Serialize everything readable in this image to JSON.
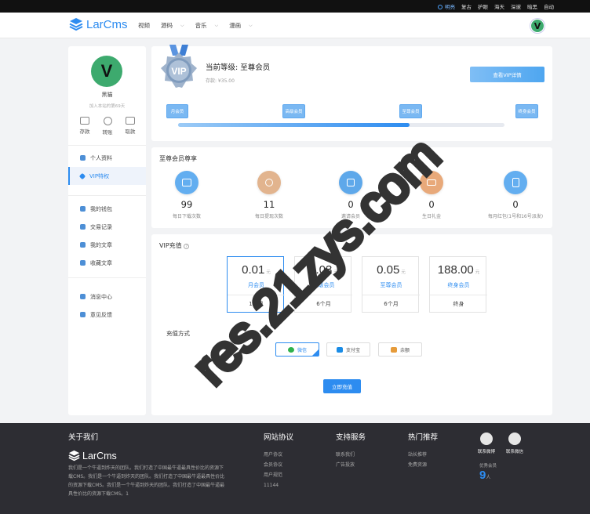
{
  "topbar": {
    "items": [
      "明亮",
      "复古",
      "护眼",
      "海天",
      "深邃",
      "暗黑",
      "自动"
    ]
  },
  "header": {
    "logo_text": "LarCms",
    "nav": [
      {
        "label": "视频",
        "caret": false
      },
      {
        "label": "源码",
        "caret": true
      },
      {
        "label": "音乐",
        "caret": true
      },
      {
        "label": "漫画",
        "caret": true
      }
    ],
    "avatar_letter": "V"
  },
  "sidebar": {
    "avatar_letter": "V",
    "username": "黑猫",
    "joined": "加入本站的第69天",
    "wallet": [
      "存款",
      "转账",
      "取款"
    ],
    "menu_group1": [
      "个人资料",
      "VIP特权"
    ],
    "menu_group2": [
      "我的钱包",
      "交易记录",
      "我的文章",
      "收藏文章"
    ],
    "menu_group3": [
      "消息中心",
      "意见反馈"
    ]
  },
  "level": {
    "badge_text": "VIP",
    "title": "当前等级: 至尊会员",
    "deposit": "存款: ¥35.00",
    "detail_button": "查看VIP详情",
    "milestones": [
      "月会员",
      "高级会员",
      "至尊会员",
      "终身会员"
    ],
    "progress": 0.71
  },
  "privileges": {
    "title": "至尊会员尊享",
    "items": [
      {
        "value": "99",
        "label": "每日下载次数",
        "color": "#63aef0"
      },
      {
        "value": "11",
        "label": "每日提现次数",
        "color": "#e2b48e"
      },
      {
        "value": "0",
        "label": "邀请会员",
        "color": "#5ea8ea"
      },
      {
        "value": "0",
        "label": "生日礼金",
        "color": "#e8a97a"
      },
      {
        "value": "0",
        "label": "每月红包(1号和16号派发)",
        "color": "#63aef0"
      }
    ]
  },
  "recharge": {
    "title": "VIP充值",
    "packages": [
      {
        "price": "0.01",
        "unit": "元",
        "name": "月会员",
        "duration": "1个月",
        "selected": true
      },
      {
        "price": "0.03",
        "unit": "元",
        "name": "高级会员",
        "duration": "6个月",
        "selected": false
      },
      {
        "price": "0.05",
        "unit": "元",
        "name": "至尊会员",
        "duration": "6个月",
        "selected": false
      },
      {
        "price": "188.00",
        "unit": "元",
        "name": "终身会员",
        "duration": "终身",
        "selected": false
      }
    ],
    "payment_label": "充值方式",
    "payments": [
      {
        "label": "微信",
        "icon_color": "#2fb24c",
        "selected": true
      },
      {
        "label": "支付宝",
        "icon_color": "#1a8ce6",
        "selected": false
      },
      {
        "label": "余额",
        "icon_color": "#e69b3a",
        "selected": false
      }
    ],
    "submit": "立即充值"
  },
  "footer": {
    "about_title": "关于我们",
    "logo_text": "LarCms",
    "about_text": "我们是一个牛逼到炸天的团队。我们打造了中国最牛逼最具性价比的资源下载CMS。我们是一个牛逼到炸天的团队。我们打造了中国最牛逼最具性价比的资源下载CMS。我们是一个牛逼到炸天的团队。我们打造了中国最牛逼最具性价比的资源下载CMS。1",
    "protocol_title": "网站协议",
    "protocol_links": [
      "用户协议",
      "会员协议",
      "用户规范",
      "11144"
    ],
    "support_title": "支持服务",
    "support_links": [
      "联系我们",
      "广告投放"
    ],
    "hot_title": "热门推荐",
    "hot_links": [
      "站长推荐",
      "免费资源"
    ],
    "social": [
      "联系微博",
      "联系微信"
    ],
    "members_label": "优秀会员",
    "members_count": "9",
    "members_unit": "人"
  },
  "watermark": "res.21zys.com"
}
